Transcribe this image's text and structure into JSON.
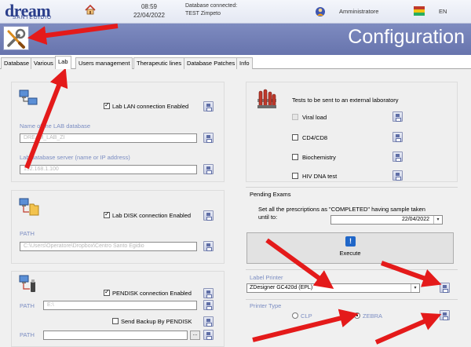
{
  "header": {
    "logo": "dream",
    "logo_sub": "SANTEGIDIO",
    "time": "08:59",
    "date": "22/04/2022",
    "db_line1": "Database connected:",
    "db_line2": "TEST Zimpeto",
    "user": "Amministratore",
    "language": "EN"
  },
  "page_title": "Configuration",
  "tabs": [
    "Database",
    "Various",
    "Lab",
    "Users management",
    "Therapeutic lines",
    "Database Patches",
    "Info"
  ],
  "active_tab": "Lab",
  "lan": {
    "checkbox_label": "Lab LAN connection Enabled",
    "name_label": "Name of the LAB database",
    "name_value": "DREAM_LAB_ZI",
    "server_label": "Lab database server (name or IP address)",
    "server_value": "192.168.1.100"
  },
  "disk": {
    "checkbox_label": "Lab DISK connection Enabled",
    "path_label": "PATH",
    "path_value": "C:\\Users\\Operatore\\Dropbox\\Centro Santo Egidio"
  },
  "pendisk": {
    "checkbox_label": "PENDISK connection Enabled",
    "path_label": "PATH",
    "path_value": "E:\\",
    "backup_label": "Send Backup By PENDISK",
    "path2_label": "PATH",
    "browse_label": "..."
  },
  "external_lab": {
    "title": "Tests to be sent to an external laboratory",
    "tests": [
      "Viral load",
      "CD4/CD8",
      "Biochemistry",
      "HIV DNA test"
    ]
  },
  "pending": {
    "title": "Pending Exams",
    "text_line1": "Set all the prescriptions as \"COMPLETED\" having sample taken",
    "text_line2": "until to:",
    "date_value": "22/04/2022",
    "execute_label": "Execute"
  },
  "label_printer": {
    "title": "Label Printer",
    "value": "ZDesigner GC420d (EPL)"
  },
  "printer_type": {
    "title": "Printer Type",
    "options": [
      "CLP",
      "ZEBRA"
    ],
    "selected": "ZEBRA"
  },
  "colors": {
    "band": "#6f7cb5",
    "arrow": "#e41a1a",
    "label_blue": "#7b8dc2"
  }
}
